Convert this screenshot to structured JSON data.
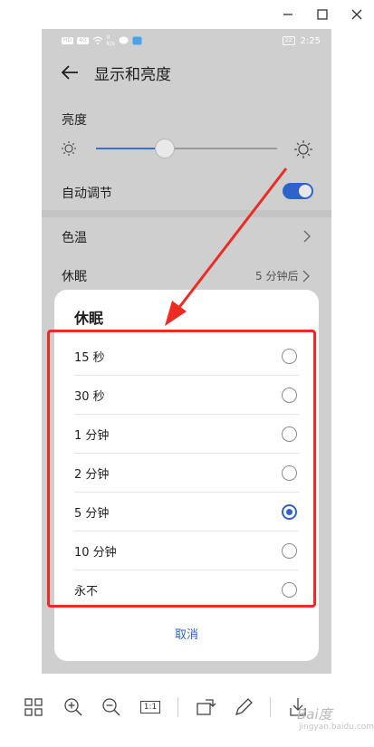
{
  "window": {
    "controls": [
      "minimize",
      "maximize",
      "close"
    ]
  },
  "status_bar": {
    "left_chips": [
      "HD",
      "4G"
    ],
    "speed_value": "0",
    "speed_unit": "K/s",
    "battery_level": "22",
    "time": "2:25"
  },
  "app_bar": {
    "title": "显示和亮度"
  },
  "settings": {
    "brightness_label": "亮度",
    "brightness_level": 0.38,
    "auto_adjust_label": "自动调节",
    "auto_adjust_on": true,
    "color_temp_label": "色温",
    "sleep_label": "休眠",
    "sleep_value": "5 分钟后"
  },
  "dialog": {
    "title": "休眠",
    "options": [
      {
        "label": "15 秒",
        "selected": false
      },
      {
        "label": "30 秒",
        "selected": false
      },
      {
        "label": "1 分钟",
        "selected": false
      },
      {
        "label": "2 分钟",
        "selected": false
      },
      {
        "label": "5 分钟",
        "selected": true
      },
      {
        "label": "10 分钟",
        "selected": false
      },
      {
        "label": "永不",
        "selected": false
      }
    ],
    "cancel_label": "取消"
  },
  "toolbar": {
    "actual_size_label": "1:1"
  },
  "watermark": {
    "text": "Bai度",
    "sub": "jingyan.baidu.com"
  },
  "colors": {
    "accent": "#2e63c9",
    "annotation": "#ee2a24",
    "overlay": "#cfcfcf"
  }
}
